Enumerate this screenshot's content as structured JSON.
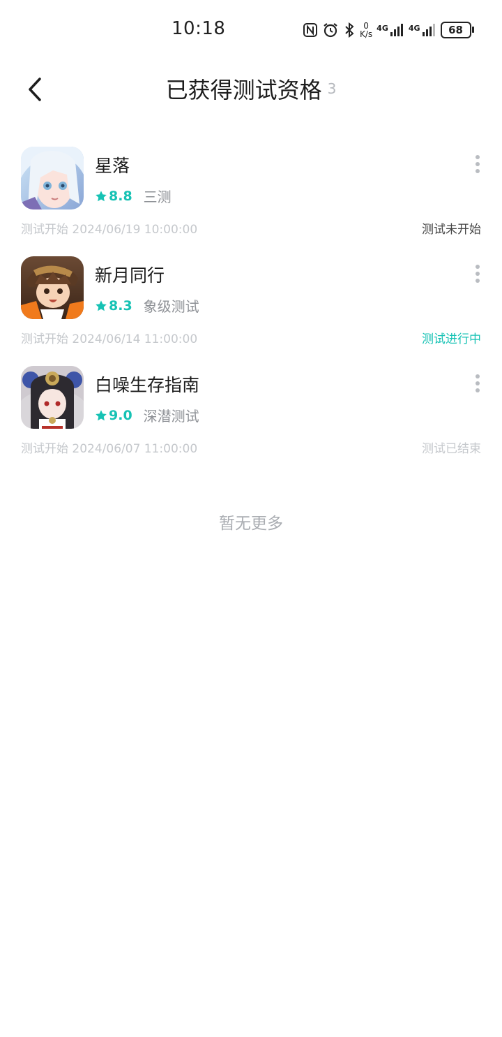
{
  "status_bar": {
    "time": "10:18",
    "net_speed_value": "0",
    "net_speed_unit": "K/s",
    "signal1_label": "4G",
    "signal2_label": "4G",
    "battery": "68"
  },
  "header": {
    "title": "已获得测试资格",
    "count": "3"
  },
  "games": [
    {
      "name": "星落",
      "score": "8.8",
      "stage": "三测",
      "start_time": "测试开始 2024/06/19 10:00:00",
      "status": "测试未开始"
    },
    {
      "name": "新月同行",
      "score": "8.3",
      "stage": "象级测试",
      "start_time": "测试开始 2024/06/14 11:00:00",
      "status": "测试进行中"
    },
    {
      "name": "白噪生存指南",
      "score": "9.0",
      "stage": "深潜测试",
      "start_time": "测试开始 2024/06/07 11:00:00",
      "status": "测试已结束"
    }
  ],
  "footer": {
    "no_more": "暂无更多"
  },
  "colors": {
    "accent": "#16c2b4",
    "muted": "#c5c8cc"
  }
}
